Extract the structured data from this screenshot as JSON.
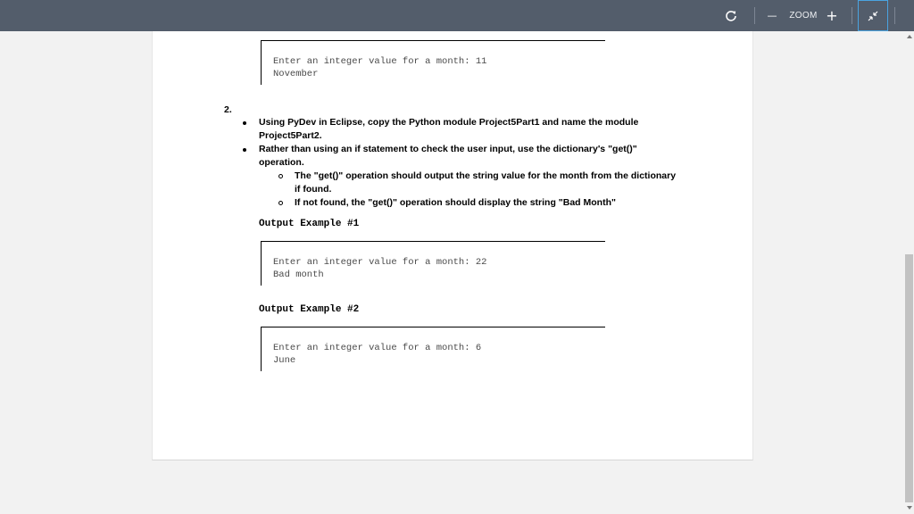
{
  "toolbar": {
    "refresh_icon": "refresh-icon",
    "zoom_out_glyph": "—",
    "zoom_label": "ZOOM",
    "zoom_in_glyph": "+",
    "fit_icon": "collapse-icon"
  },
  "document": {
    "top_console": {
      "prompt": "Enter an integer value for a month: 11",
      "output": "November"
    },
    "question_number": "2.",
    "bullets": [
      {
        "line1": "Using PyDev in Eclipse, copy the Python module Project5Part1 and name the module",
        "line2": "Project5Part2."
      },
      {
        "line1": "Rather than using an if statement to check the user input, use the dictionary's \"get()\"",
        "line2": "operation."
      }
    ],
    "sub_bullets": [
      {
        "line1": "The \"get()\" operation should output the string value for the month from the dictionary",
        "line2": "if found."
      },
      {
        "line1": "If not found, the \"get()\" operation should display the string \"Bad Month\""
      }
    ],
    "example1": {
      "heading": "Output Example #1",
      "prompt": "Enter an integer value for a month: 22",
      "output": "Bad month"
    },
    "example2": {
      "heading": "Output Example #2",
      "prompt": "Enter an integer value for a month: 6",
      "output": "June"
    }
  },
  "colors": {
    "toolbar": "#535d6b",
    "page": "#ffffff",
    "background": "#f2f2f2",
    "fit_highlight": "#4aa3e0"
  }
}
